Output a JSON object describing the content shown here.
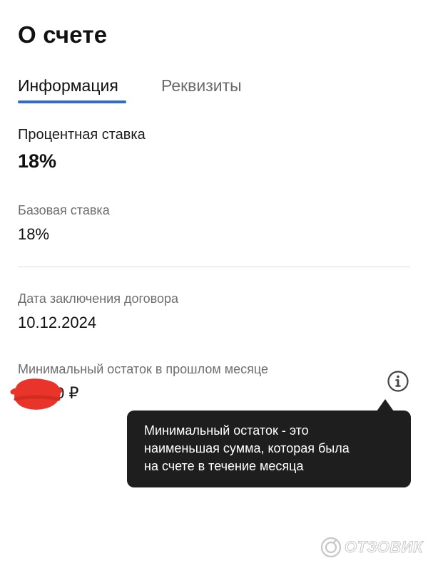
{
  "header": {
    "title": "О счете"
  },
  "tabs": [
    {
      "label": "Информация",
      "active": true
    },
    {
      "label": "Реквизиты",
      "active": false
    }
  ],
  "interest_rate": {
    "label": "Процентная ставка",
    "value": "18%"
  },
  "base_rate": {
    "label": "Базовая ставка",
    "value": "18%"
  },
  "contract_date": {
    "label": "Дата заключения договора",
    "value": "10.12.2024"
  },
  "min_balance": {
    "label": "Минимальный остаток в прошлом месяце",
    "value_visible": "0 ₽"
  },
  "tooltip": {
    "line1": "Минимальный остаток  - это",
    "line2": "наименьшая сумма, которая была",
    "line3": "на счете в течение месяца"
  },
  "watermark": {
    "text": "ОТЗОВИК"
  },
  "colors": {
    "accent": "#2e6bd6",
    "tooltip_bg": "#1e1e1e",
    "redaction": "#e8342a",
    "muted_text": "#6e6e6e"
  },
  "icons": {
    "info": "info-circle-icon",
    "watermark_logo": "otzovik-logo-icon"
  }
}
